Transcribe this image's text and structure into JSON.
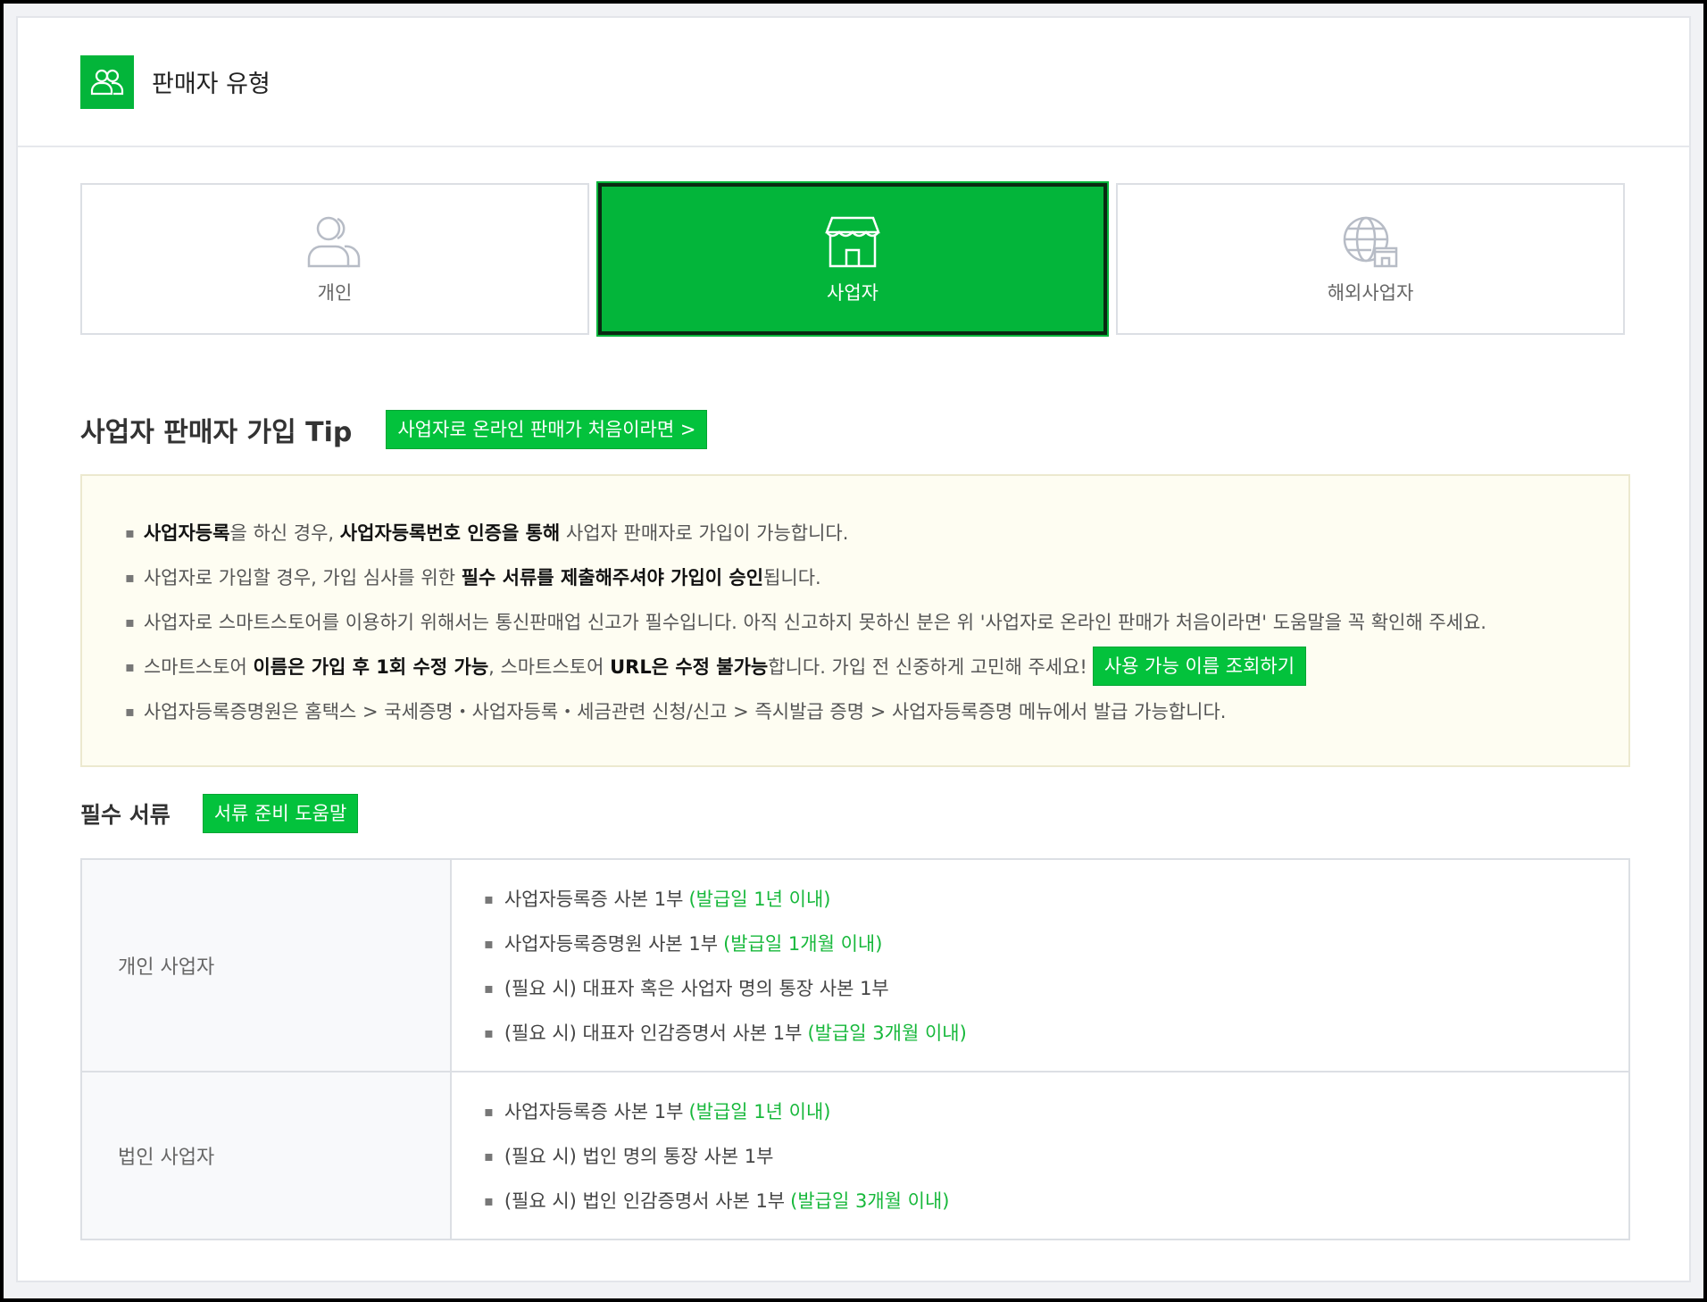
{
  "header": {
    "title": "판매자 유형",
    "icon": "users-icon"
  },
  "seller_types": [
    {
      "label": "개인",
      "icon": "person-icon",
      "selected": false
    },
    {
      "label": "사업자",
      "icon": "store-icon",
      "selected": true
    },
    {
      "label": "해외사업자",
      "icon": "globe-store-icon",
      "selected": false
    }
  ],
  "tip": {
    "title": "사업자 판매자 가입 Tip",
    "link_label": "사업자로 온라인 판매가 처음이라면 >",
    "lines": {
      "l1": {
        "b1": "사업자등록",
        "t1": "을 하신 경우, ",
        "b2": "사업자등록번호 인증을 통해",
        "t2": " 사업자 판매자로 가입이 가능합니다."
      },
      "l2": {
        "t1": "사업자로 가입할 경우, 가입 심사를 위한 ",
        "b1": "필수 서류를 제출해주셔야 가입이 승인",
        "t2": "됩니다."
      },
      "l3": {
        "t1": "사업자로 스마트스토어를 이용하기 위해서는 통신판매업 신고가 필수입니다. 아직 신고하지 못하신 분은 위 '사업자로 온라인 판매가 처음이라면' 도움말을 꼭 확인해 주세요."
      },
      "l4": {
        "t1": "스마트스토어 ",
        "b1": "이름은 가입 후 1회 수정 가능",
        "t2": ", 스마트스토어 ",
        "b2": "URL은 수정 불가능",
        "t3": "합니다. 가입 전 신중하게 고민해 주세요!",
        "button": "사용 가능 이름 조회하기"
      },
      "l5": {
        "t1": "사업자등록증명원은 홈택스 > 국세증명・사업자등록・세금관련 신청/신고 > 즉시발급 증명 > 사업자등록증명 메뉴에서 발급 가능합니다."
      }
    }
  },
  "docs": {
    "title": "필수 서류",
    "help_label": "서류 준비 도움말",
    "rows": [
      {
        "kind": "개인 사업자",
        "items": [
          {
            "text": "사업자등록증 사본 1부",
            "note": "(발급일 1년 이내)"
          },
          {
            "text": "사업자등록증명원 사본 1부",
            "note": "(발급일 1개월 이내)"
          },
          {
            "text": "(필요 시) 대표자 혹은 사업자 명의 통장 사본 1부",
            "note": ""
          },
          {
            "text": "(필요 시) 대표자 인감증명서 사본 1부",
            "note": "(발급일 3개월 이내)"
          }
        ]
      },
      {
        "kind": "법인 사업자",
        "items": [
          {
            "text": "사업자등록증 사본 1부",
            "note": "(발급일 1년 이내)"
          },
          {
            "text": "(필요 시) 법인 명의 통장 사본 1부",
            "note": ""
          },
          {
            "text": "(필요 시) 법인 인감증명서 사본 1부",
            "note": "(발급일 3개월 이내)"
          }
        ]
      }
    ]
  },
  "colors": {
    "accent": "#03b53a",
    "note": "#17b83b",
    "tip_bg": "#fefdf2"
  }
}
